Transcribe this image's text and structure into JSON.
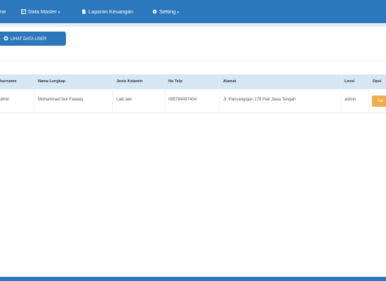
{
  "navbar": {
    "items": [
      {
        "label": "me",
        "icon": "none"
      },
      {
        "label": "Data Master",
        "icon": "table-icon",
        "caret": "▾"
      },
      {
        "label": "Laporan Keuangan",
        "icon": "file-icon"
      },
      {
        "label": "Setting",
        "icon": "gear-icon",
        "caret": "▾"
      }
    ]
  },
  "actions": {
    "view_users_label": "LIHAT DATA USER"
  },
  "table": {
    "headers": [
      "Username",
      "Nama Lengkap",
      "Jenis Kelamin",
      "No Telp",
      "Alamat",
      "Level",
      "Opsi"
    ],
    "rows": [
      {
        "username": "admin",
        "nama": "Mohammad Nur Fawaiq",
        "jk": "Laki laki",
        "telp": "085784497404",
        "alamat": "Jl. Pancangojan 178 Pati Jawa Tengah",
        "level": "admin",
        "action_label": "Sa"
      }
    ]
  },
  "colors": {
    "navbar": "#2d78bd",
    "header_row": "#d6e6f3",
    "action_button": "#f0ad4e"
  }
}
